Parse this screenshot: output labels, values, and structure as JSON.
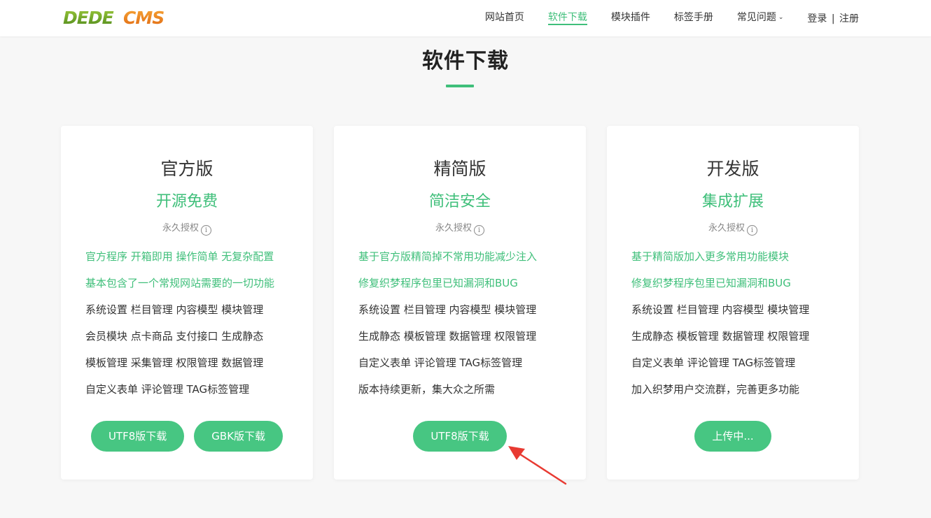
{
  "header": {
    "logo_text": "DEDECMS",
    "nav": [
      {
        "label": "网站首页",
        "active": false
      },
      {
        "label": "软件下载",
        "active": true
      },
      {
        "label": "模块插件",
        "active": false
      },
      {
        "label": "标签手册",
        "active": false
      },
      {
        "label": "常见问题",
        "active": false
      }
    ],
    "login_label": "登录",
    "separator": "|",
    "register_label": "注册"
  },
  "page": {
    "title": "软件下载"
  },
  "cards": [
    {
      "name": "官方版",
      "slogan": "开源免费",
      "license": "永久授权",
      "features": [
        "官方程序 开箱即用 操作简单 无复杂配置",
        "基本包含了一个常规网站需要的一切功能",
        "系统设置 栏目管理 内容模型 模块管理",
        "会员模块 点卡商品 支付接口 生成静态",
        "模板管理 采集管理 权限管理 数据管理",
        "自定义表单 评论管理 TAG标签管理"
      ],
      "buttons": [
        "UTF8版下载",
        "GBK版下载"
      ]
    },
    {
      "name": "精简版",
      "slogan": "简洁安全",
      "license": "永久授权",
      "features": [
        "基于官方版精简掉不常用功能减少注入",
        "修复织梦程序包里已知漏洞和BUG",
        "系统设置 栏目管理 内容模型 模块管理",
        "生成静态 模板管理 数据管理 权限管理",
        "自定义表单 评论管理 TAG标签管理",
        "版本持续更新，集大众之所需"
      ],
      "buttons": [
        "UTF8版下载"
      ]
    },
    {
      "name": "开发版",
      "slogan": "集成扩展",
      "license": "永久授权",
      "features": [
        "基于精简版加入更多常用功能模块",
        "修复织梦程序包里已知漏洞和BUG",
        "系统设置 栏目管理 内容模型 模块管理",
        "生成静态 模板管理 数据管理 权限管理",
        "自定义表单 评论管理 TAG标签管理",
        "加入织梦用户交流群，完善更多功能"
      ],
      "buttons": [
        "上传中..."
      ]
    }
  ],
  "colors": {
    "accent": "#3fbf7a",
    "button": "#47c682",
    "arrow": "#e83a32"
  }
}
